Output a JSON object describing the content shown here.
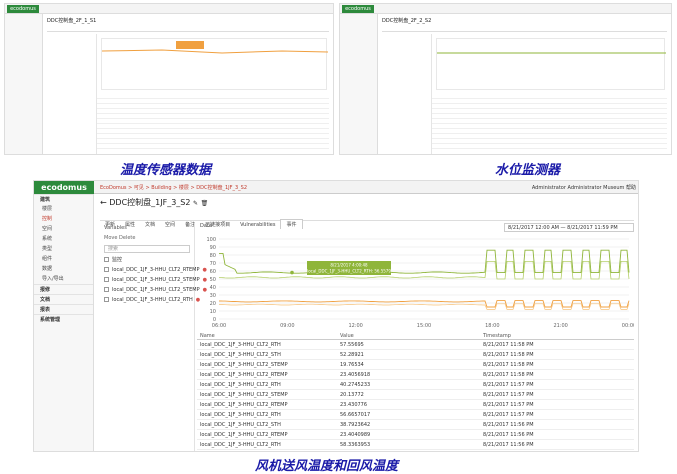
{
  "captions": {
    "top_left": "温度传感器数据",
    "top_right": "水位监测器",
    "bottom": "风机送风温度和回风温度"
  },
  "shot1": {
    "title": "DDC控制盘_2F_1_S1"
  },
  "shot2": {
    "title": "DDC控制盘_2F_2_S2"
  },
  "app": {
    "logo": "ecodomus",
    "breadcrumbs": "EcoDomus > 可见 > Building > 楼层 > DDC控制盘_1JF_3_S2",
    "user": "Administrator Administrator",
    "museum": "Museum",
    "help": "帮助",
    "page_title": "DDC控制盘_1JF_3_S2"
  },
  "sidebar": [
    {
      "label": "建筑",
      "kind": "grp"
    },
    {
      "label": "楼层",
      "kind": "sub"
    },
    {
      "label": "控制",
      "kind": "sub act"
    },
    {
      "label": "空间",
      "kind": "sub"
    },
    {
      "label": "系统",
      "kind": "sub"
    },
    {
      "label": "类型",
      "kind": "sub"
    },
    {
      "label": "组件",
      "kind": "sub"
    },
    {
      "label": "数据",
      "kind": "sub"
    },
    {
      "label": "导入/导出",
      "kind": "sub"
    },
    {
      "label": "报修",
      "kind": "grp"
    },
    {
      "label": "文档",
      "kind": "grp"
    },
    {
      "label": "报表",
      "kind": "grp"
    },
    {
      "label": "系统管理",
      "kind": "grp"
    }
  ],
  "tabs": [
    "更新",
    "属性",
    "文档",
    "空间",
    "备注",
    "已链接项目",
    "Vulnerabilities",
    "事件"
  ],
  "variables": {
    "label": "Variables",
    "buttons": "Move   Delete",
    "search_placeholder": "搜索",
    "section": "监控",
    "items": [
      "local_DDC_1JF_3-HHU_CLT2_RTEMP",
      "local_DDC_1JF_3-HHU_CLT2_STEMP",
      "local_DDC_1JF_3-HHU_CLT2_STEMP",
      "local_DDC_1JF_3-HHU_CLT2_RTH"
    ]
  },
  "data_label": "Data",
  "date_range": "8/21/2017 12:00 AM — 8/21/2017 11:59 PM",
  "tooltip": {
    "time": "8/21/2017 4:00:48",
    "text": "local_DDC_1JF_3-HHU_CLT2_RTH: 56.5579"
  },
  "chart_data": {
    "type": "line",
    "x_ticks": [
      "06:00",
      "09:00",
      "12:00",
      "15:00",
      "18:00",
      "21:00",
      "00:00"
    ],
    "ylim": [
      0,
      100
    ],
    "y_ticks": [
      0,
      10,
      20,
      30,
      40,
      50,
      60,
      70,
      80,
      90,
      100
    ],
    "grid": true,
    "colors": {
      "green": "#8fb53a",
      "orange": "#f0a040"
    }
  },
  "table": {
    "headers": [
      "Name",
      "Value",
      "Timestamp"
    ],
    "rows": [
      [
        "local_DDC_1JF_3-HHU_CLT2_RTH",
        "57.55695",
        "8/21/2017 11:58 PM"
      ],
      [
        "local_DDC_1JF_3-HHU_CLT2_STH",
        "52.28921",
        "8/21/2017 11:58 PM"
      ],
      [
        "local_DDC_1JF_3-HHU_CLT2_STEMP",
        "19.76534",
        "8/21/2017 11:58 PM"
      ],
      [
        "local_DDC_1JF_3-HHU_CLT2_RTEMP",
        "23.4056918",
        "8/21/2017 11:58 PM"
      ],
      [
        "local_DDC_1JF_3-HHU_CLT2_RTH",
        "40.2745233",
        "8/21/2017 11:57 PM"
      ],
      [
        "local_DDC_1JF_3-HHU_CLT2_STEMP",
        "20.13772",
        "8/21/2017 11:57 PM"
      ],
      [
        "local_DDC_1JF_3-HHU_CLT2_RTEMP",
        "23.430776",
        "8/21/2017 11:57 PM"
      ],
      [
        "local_DDC_1JF_3-HHU_CLT2_RTH",
        "56.6657017",
        "8/21/2017 11:57 PM"
      ],
      [
        "local_DDC_1JF_3-HHU_CLT2_STH",
        "38.7923642",
        "8/21/2017 11:56 PM"
      ],
      [
        "local_DDC_1JF_3-HHU_CLT2_RTEMP",
        "23.4040989",
        "8/21/2017 11:56 PM"
      ],
      [
        "local_DDC_1JF_3-HHU_CLT2_RTH",
        "58.3363953",
        "8/21/2017 11:56 PM"
      ],
      [
        "local_DDC_1JF_3-HHU_CLT2_STEMP",
        "20.695326",
        "8/21/2017 11:56 PM"
      ]
    ]
  }
}
